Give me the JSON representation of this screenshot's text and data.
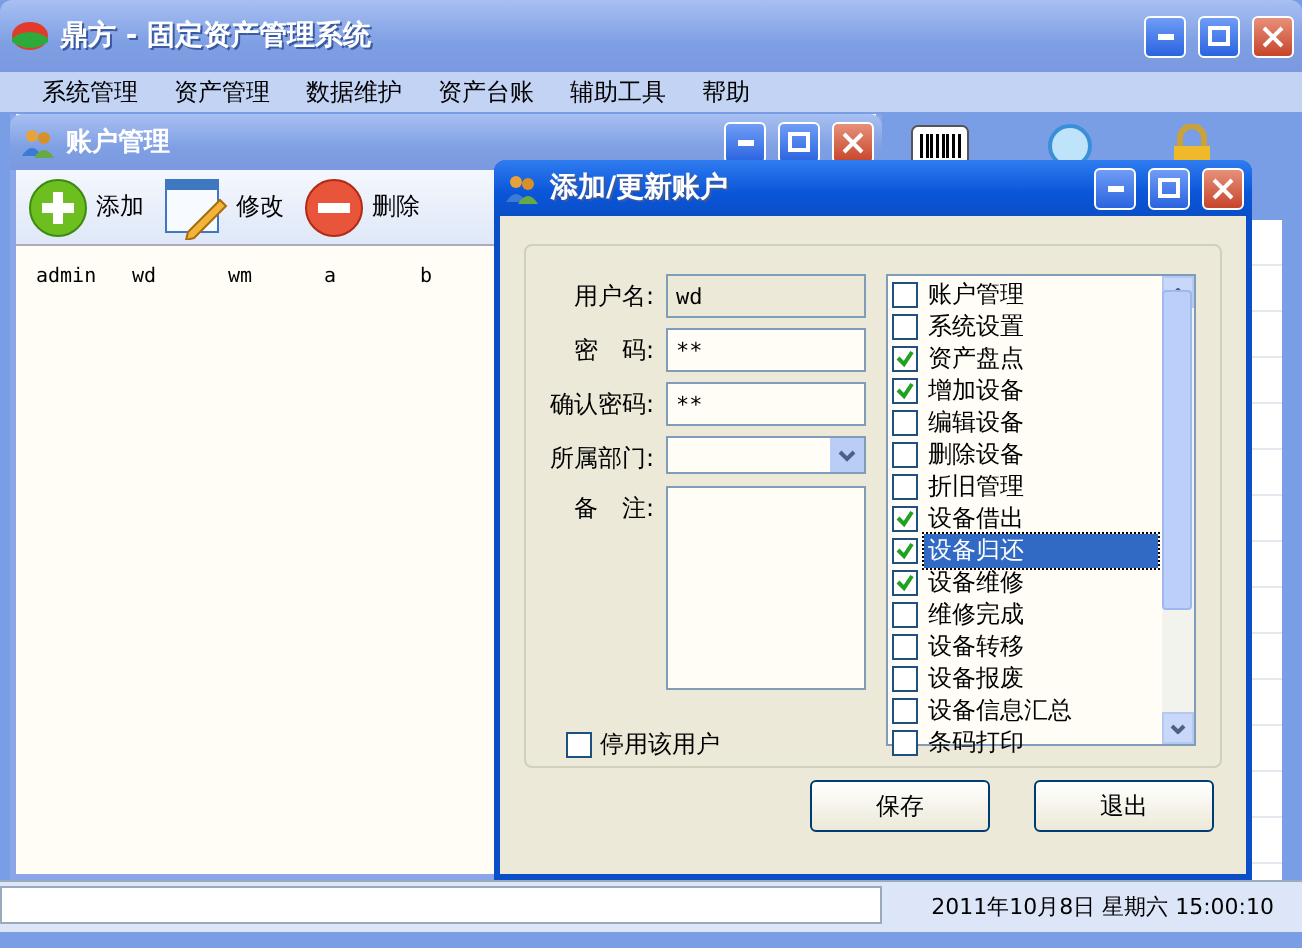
{
  "window": {
    "title": "鼎方 - 固定资产管理系统"
  },
  "menu": [
    "系统管理",
    "资产管理",
    "数据维护",
    "资产台账",
    "辅助工具",
    "帮助"
  ],
  "account_window": {
    "title": "账户管理",
    "toolbar": [
      {
        "label": "添加",
        "kind": "add"
      },
      {
        "label": "修改",
        "kind": "edit"
      },
      {
        "label": "删除",
        "kind": "delete"
      }
    ],
    "users": [
      "admin",
      "wd",
      "wm",
      "a",
      "b"
    ]
  },
  "dialog": {
    "title": "添加/更新账户",
    "fields": [
      {
        "label": "用户名:",
        "value": "wd",
        "kind": "readonly"
      },
      {
        "label": "密　码:",
        "value": "**",
        "kind": "text"
      },
      {
        "label": "确认密码:",
        "value": "**",
        "kind": "text"
      },
      {
        "label": "所属部门:",
        "kind": "select"
      },
      {
        "label": "备　注:",
        "kind": "textarea"
      }
    ],
    "disable_user": {
      "label": "停用该用户",
      "checked": false
    },
    "permissions": [
      {
        "label": "账户管理",
        "checked": false,
        "selected": false
      },
      {
        "label": "系统设置",
        "checked": false,
        "selected": false
      },
      {
        "label": "资产盘点",
        "checked": true,
        "selected": false
      },
      {
        "label": "增加设备",
        "checked": true,
        "selected": false
      },
      {
        "label": "编辑设备",
        "checked": false,
        "selected": false
      },
      {
        "label": "删除设备",
        "checked": false,
        "selected": false
      },
      {
        "label": "折旧管理",
        "checked": false,
        "selected": false
      },
      {
        "label": "设备借出",
        "checked": true,
        "selected": false
      },
      {
        "label": "设备归还",
        "checked": true,
        "selected": true
      },
      {
        "label": "设备维修",
        "checked": true,
        "selected": false
      },
      {
        "label": "维修完成",
        "checked": false,
        "selected": false
      },
      {
        "label": "设备转移",
        "checked": false,
        "selected": false
      },
      {
        "label": "设备报废",
        "checked": false,
        "selected": false
      },
      {
        "label": "设备信息汇总",
        "checked": false,
        "selected": false
      },
      {
        "label": "条码打印",
        "checked": false,
        "selected": false
      }
    ],
    "buttons": [
      "保存",
      "退出"
    ]
  },
  "status_bar": {
    "datetime": "2011年10月8日 星期六 15:00:10"
  }
}
